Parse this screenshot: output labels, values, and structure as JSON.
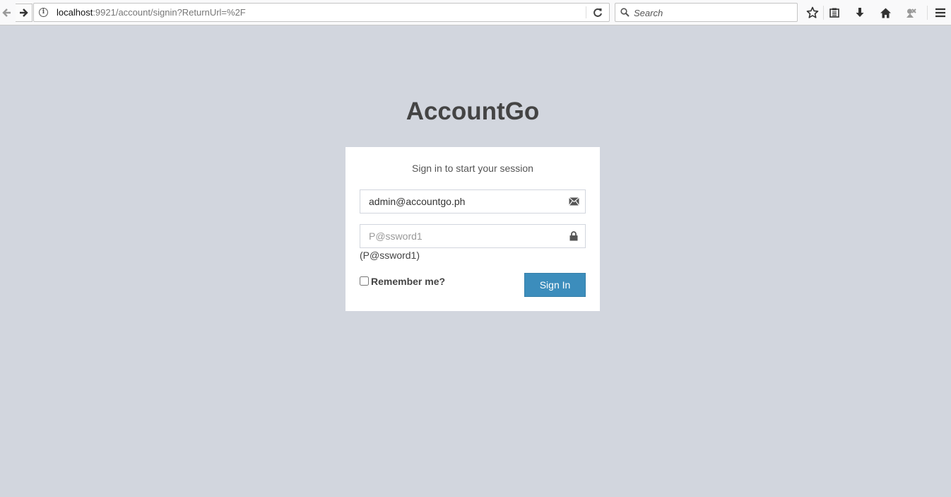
{
  "browser": {
    "url_host": "localhost",
    "url_path": ":9921/account/signin?ReturnUrl=%2F",
    "search_placeholder": "Search"
  },
  "page": {
    "logo": "AccountGo",
    "login_message": "Sign in to start your session",
    "email": {
      "value": "admin@accountgo.ph",
      "icon": "envelope-icon"
    },
    "password": {
      "placeholder": "P@ssword1",
      "icon": "lock-icon"
    },
    "password_hint": "(P@ssword1)",
    "remember_label": "Remember me?",
    "remember_checked": false,
    "signin_label": "Sign In"
  },
  "colors": {
    "background": "#d2d6de",
    "primary_button": "#3c8dbc"
  }
}
